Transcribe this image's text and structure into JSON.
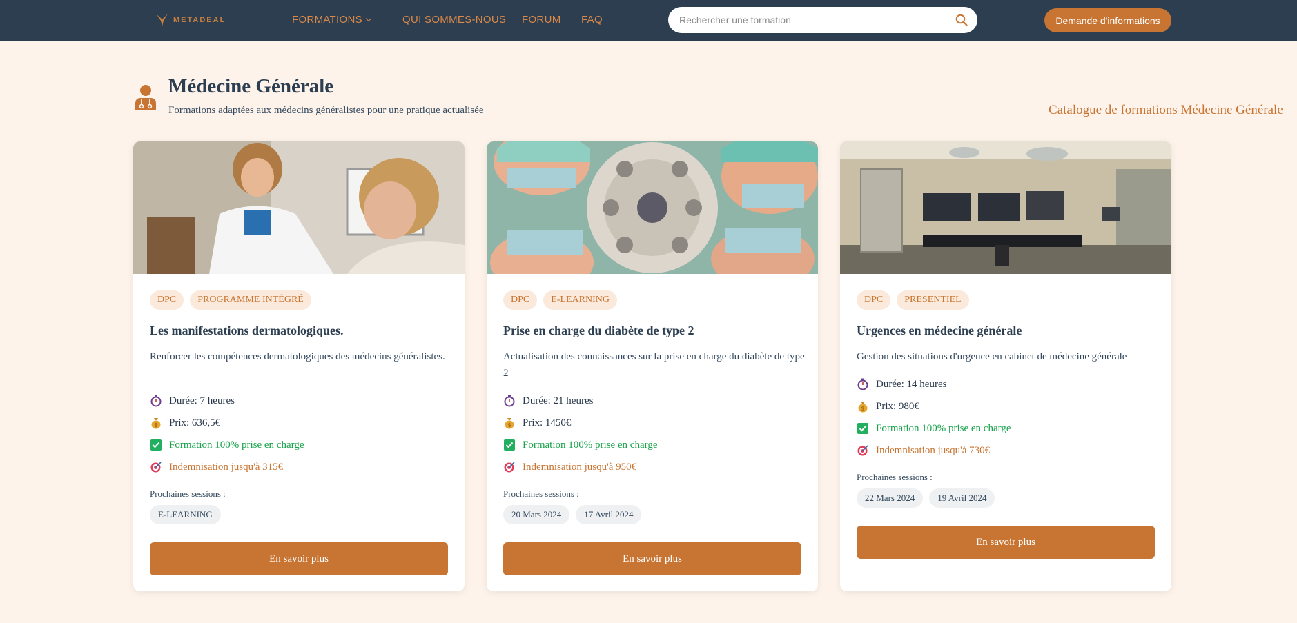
{
  "nav": {
    "logo_text": "METADEAL",
    "links": [
      {
        "label": "FORMATIONS",
        "has_dropdown": true
      },
      {
        "label": "QUI SOMMES-NOUS"
      },
      {
        "label": "FORUM"
      },
      {
        "label": "FAQ"
      }
    ],
    "search_placeholder": "Rechercher une formation",
    "cta_label": "Demande d'informations"
  },
  "header": {
    "title": "Médecine Générale",
    "subtitle": "Formations adaptées aux médecins généralistes pour une pratique actualisée",
    "catalog_link": "Catalogue de formations Médecine Générale"
  },
  "cards": [
    {
      "tags": [
        "DPC",
        "PROGRAMME INTÉGRÉ"
      ],
      "title": "Les manifestations dermatologiques.",
      "description": "Renforcer les compétences dermatologiques des médecins généralistes.",
      "duration": "Durée: 7 heures",
      "price": "Prix: 636,5€",
      "coverage": "Formation 100% prise en charge",
      "indemnity": "Indemnisation jusqu'à 315€",
      "sessions_label": "Prochaines sessions :",
      "sessions": [
        "E-LEARNING"
      ],
      "button": "En savoir plus"
    },
    {
      "tags": [
        "DPC",
        "E-LEARNING"
      ],
      "title": "Prise en charge du diabète de type 2",
      "description": "Actualisation des connaissances sur la prise en charge du diabète de type 2",
      "duration": "Durée: 21 heures",
      "price": "Prix: 1450€",
      "coverage": "Formation 100% prise en charge",
      "indemnity": "Indemnisation jusqu'à 950€",
      "sessions_label": "Prochaines sessions :",
      "sessions": [
        "20 Mars 2024",
        "17 Avril 2024"
      ],
      "button": "En savoir plus"
    },
    {
      "tags": [
        "DPC",
        "PRESENTIEL"
      ],
      "title": "Urgences en médecine générale",
      "description": "Gestion des situations d'urgence en cabinet de médecine générale",
      "duration": "Durée: 14 heures",
      "price": "Prix: 980€",
      "coverage": "Formation 100% prise en charge",
      "indemnity": "Indemnisation jusqu'à 730€",
      "sessions_label": "Prochaines sessions :",
      "sessions": [
        "22 Mars 2024",
        "19 Avril 2024"
      ],
      "button": "En savoir plus"
    }
  ],
  "icons": {
    "duration": "stopwatch-icon",
    "price": "money-bag-icon",
    "coverage": "check-box-icon",
    "indemnity": "target-icon",
    "search": "search-icon",
    "header": "doctor-icon"
  },
  "colors": {
    "nav_bg": "#2c3e50",
    "accent": "#c87533",
    "page_bg": "#fdf3ea",
    "success": "#18a34a"
  }
}
